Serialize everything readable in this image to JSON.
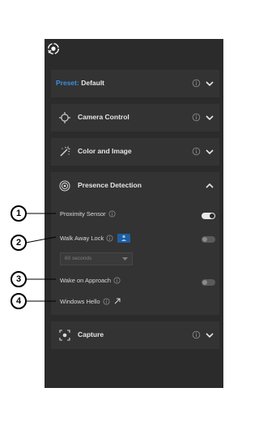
{
  "preset": {
    "key": "Preset:",
    "value": "Default"
  },
  "sections": {
    "camera_control": "Camera Control",
    "color_image": "Color and Image",
    "presence": "Presence Detection",
    "capture": "Capture"
  },
  "presence_rows": {
    "proximity": "Proximity Sensor",
    "walk_away": "Walk Away Lock",
    "walk_away_select": "60 seconds",
    "wake": "Wake on Approach",
    "windows_hello": "Windows Hello"
  },
  "toggles": {
    "proximity": "on",
    "walk_away": "off",
    "wake": "off"
  },
  "callouts": [
    "1",
    "2",
    "3",
    "4"
  ],
  "icons": {
    "app": "app-settings-icon",
    "camera_control": "crosshair-icon",
    "color_image": "magic-wand-icon",
    "presence": "presence-sensor-icon",
    "capture": "capture-icon"
  },
  "colors": {
    "panel": "#2b2b2b",
    "section": "#333333",
    "accent": "#3d8fe0",
    "text": "#e6e6e6"
  }
}
